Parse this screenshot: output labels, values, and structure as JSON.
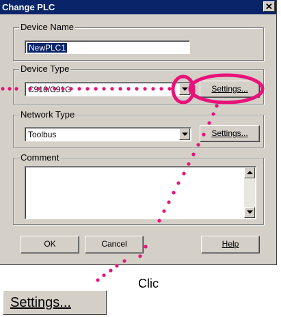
{
  "dialog": {
    "title": "Change PLC",
    "close_glyph": "✕",
    "device_name": {
      "legend": "Device Name",
      "value": "NewPLC1"
    },
    "device_type": {
      "legend": "Device Type",
      "value": "C916/C91G",
      "settings_label": "Settings..."
    },
    "network_type": {
      "legend": "Network Type",
      "value": "Toolbus",
      "settings_label": "Settings..."
    },
    "comment": {
      "legend": "Comment",
      "value": ""
    },
    "buttons": {
      "ok": "OK",
      "cancel": "Cancel",
      "help": "Help"
    }
  },
  "annotation": {
    "click_label": "Clic",
    "zoom_settings_label": "Settings...",
    "highlight_color": "#e8127a"
  }
}
